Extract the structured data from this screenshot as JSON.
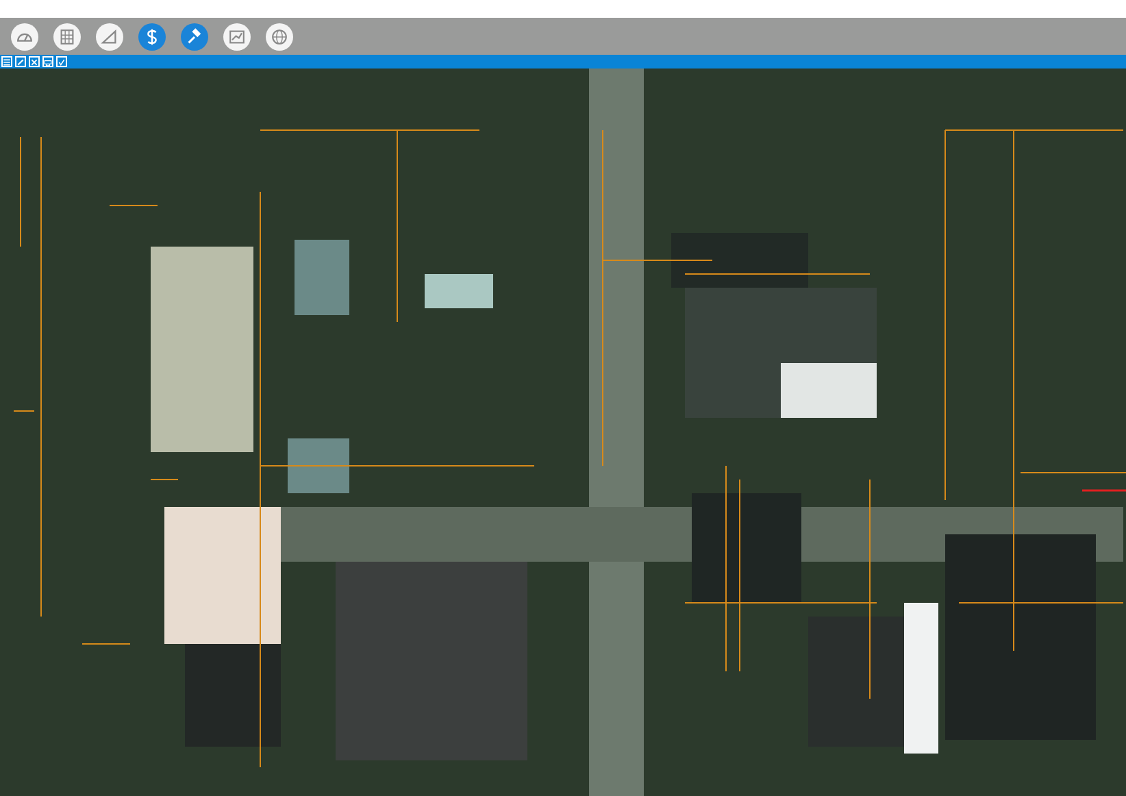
{
  "toolbar": {
    "tools": [
      {
        "kind": "gauge",
        "selected": false
      },
      {
        "kind": "grid",
        "selected": false
      },
      {
        "kind": "triangle",
        "selected": false
      },
      {
        "kind": "dollar",
        "selected": true
      },
      {
        "kind": "gavel",
        "selected": true
      },
      {
        "kind": "chart",
        "selected": false
      },
      {
        "kind": "globe",
        "selected": false
      }
    ]
  },
  "quick_tools": [
    {
      "kind": "list"
    },
    {
      "kind": "pencil"
    },
    {
      "kind": "cross"
    },
    {
      "kind": "print"
    },
    {
      "kind": "check"
    }
  ]
}
